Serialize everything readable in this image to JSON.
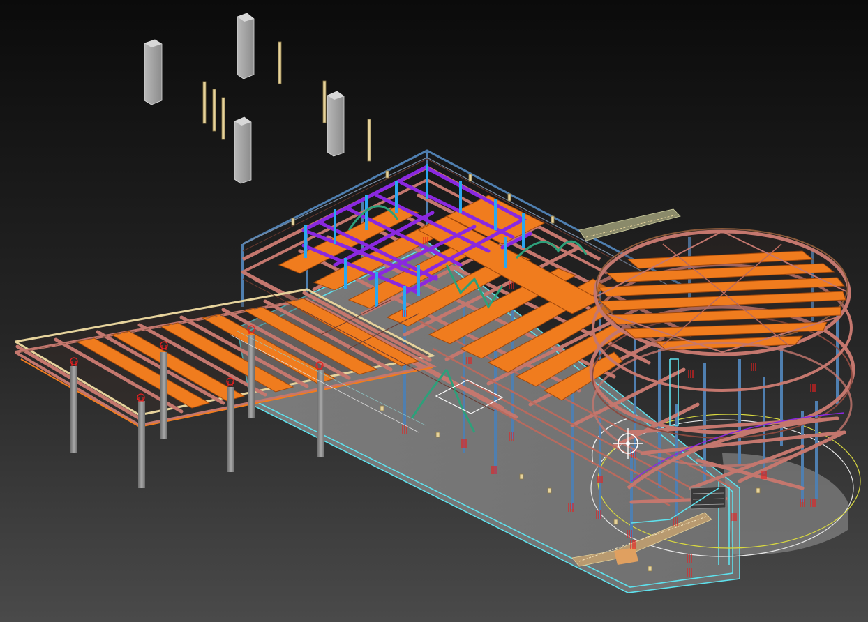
{
  "viewport": {
    "background_top": "#0b0b0b",
    "background_bottom": "#4a4a4a",
    "shading_mode": "wireframe-over-shaded",
    "objects": [
      "steel-frame-structure",
      "timber-deck-beams",
      "circular-platform",
      "canopy-roof",
      "concrete-ground-slab",
      "pile-foundations",
      "bracket-columns",
      "stair",
      "selection-gizmo"
    ]
  },
  "colors": {
    "steel_beam": "#c4776e",
    "steel_column": "#4f7fb0",
    "timber_deck": "#f07c1e",
    "purple_frame": "#8a28e0",
    "blue_post": "#2aa7f0",
    "selection_outline": "#5ee2ee",
    "anchor_bolts": "#e82020",
    "bracing": "#2da07a",
    "post_tan": "#e6d39c",
    "concrete": "#8a8a8a"
  }
}
